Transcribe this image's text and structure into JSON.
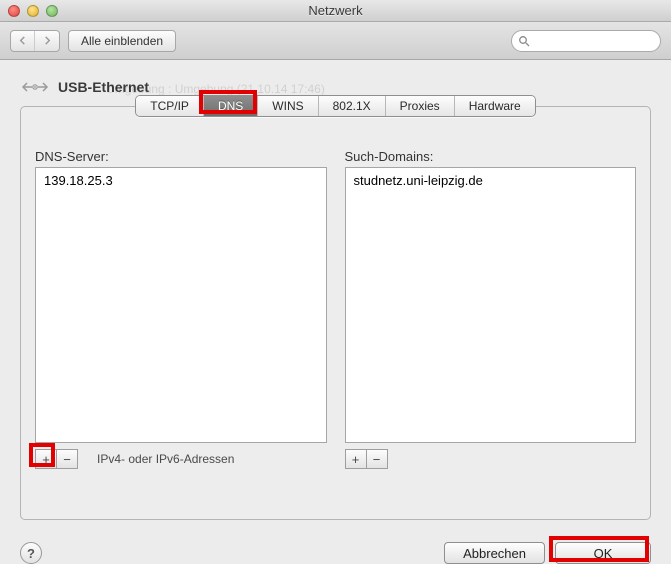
{
  "window": {
    "title": "Netzwerk"
  },
  "toolbar": {
    "show_all": "Alle einblenden"
  },
  "connection": {
    "name": "USB-Ethernet"
  },
  "ghost": {
    "line": "Umgebung :   Umgebung (21.10.14 17:46)"
  },
  "tabs": {
    "items": [
      "TCP/IP",
      "DNS",
      "WINS",
      "802.1X",
      "Proxies",
      "Hardware"
    ],
    "active_index": 1
  },
  "dns": {
    "server_label": "DNS-Server:",
    "servers": [
      "139.18.25.3"
    ],
    "domain_label": "Such-Domains:",
    "domains": [
      "studnetz.uni-leipzig.de"
    ],
    "hint": "IPv4- oder IPv6-Adressen"
  },
  "buttons": {
    "cancel": "Abbrechen",
    "ok": "OK"
  }
}
